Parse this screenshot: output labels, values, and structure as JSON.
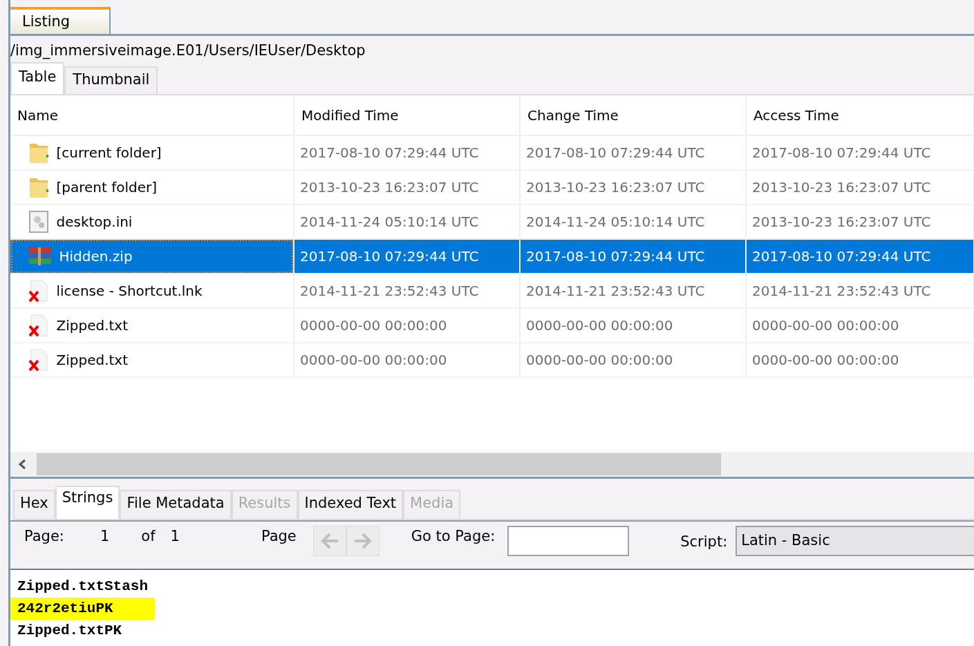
{
  "top_tabs": [
    {
      "label": "Listing",
      "selected": true
    }
  ],
  "path": "/img_immersiveimage.E01/Users/IEUser/Desktop",
  "view_tabs": [
    {
      "label": "Table",
      "selected": true
    },
    {
      "label": "Thumbnail",
      "selected": false
    }
  ],
  "table": {
    "columns": [
      "Name",
      "Modified Time",
      "Change Time",
      "Access Time"
    ],
    "rows": [
      {
        "kind": "folder",
        "name": "[current folder]",
        "modified": "2017-08-10 07:29:44 UTC",
        "changed": "2017-08-10 07:29:44 UTC",
        "accessed": "2017-08-10 07:29:44 UTC",
        "selected": false
      },
      {
        "kind": "folder",
        "name": "[parent folder]",
        "modified": "2013-10-23 16:23:07 UTC",
        "changed": "2013-10-23 16:23:07 UTC",
        "accessed": "2013-10-23 16:23:07 UTC",
        "selected": false
      },
      {
        "kind": "settings",
        "name": "desktop.ini",
        "modified": "2014-11-24 05:10:14 UTC",
        "changed": "2014-11-24 05:10:14 UTC",
        "accessed": "2013-10-23 16:23:07 UTC",
        "selected": false
      },
      {
        "kind": "archive",
        "name": "Hidden.zip",
        "modified": "2017-08-10 07:29:44 UTC",
        "changed": "2017-08-10 07:29:44 UTC",
        "accessed": "2017-08-10 07:29:44 UTC",
        "selected": true
      },
      {
        "kind": "deleted",
        "name": "license - Shortcut.lnk",
        "modified": "2014-11-21 23:52:43 UTC",
        "changed": "2014-11-21 23:52:43 UTC",
        "accessed": "2014-11-21 23:52:43 UTC",
        "selected": false
      },
      {
        "kind": "deleted",
        "name": "Zipped.txt",
        "modified": "0000-00-00 00:00:00",
        "changed": "0000-00-00 00:00:00",
        "accessed": "0000-00-00 00:00:00",
        "selected": false
      },
      {
        "kind": "deleted",
        "name": "Zipped.txt",
        "modified": "0000-00-00 00:00:00",
        "changed": "0000-00-00 00:00:00",
        "accessed": "0000-00-00 00:00:00",
        "selected": false
      }
    ]
  },
  "content_tabs": [
    {
      "label": "Hex",
      "selected": false,
      "disabled": false
    },
    {
      "label": "Strings",
      "selected": true,
      "disabled": false
    },
    {
      "label": "File Metadata",
      "selected": false,
      "disabled": false
    },
    {
      "label": "Results",
      "selected": false,
      "disabled": true
    },
    {
      "label": "Indexed Text",
      "selected": false,
      "disabled": false
    },
    {
      "label": "Media",
      "selected": false,
      "disabled": true
    }
  ],
  "pager": {
    "page_label": "Page:",
    "page": "1",
    "of_label": "of",
    "total": "1",
    "page_nav_label": "Page",
    "goto_label": "Go to Page:",
    "script_label": "Script:",
    "script_value": "Latin - Basic"
  },
  "strings": [
    {
      "text": "Zipped.txtStash",
      "highlighted": false
    },
    {
      "text": "242r2etiuPK",
      "highlighted": true
    },
    {
      "text": "Zipped.txtPK",
      "highlighted": false
    }
  ]
}
